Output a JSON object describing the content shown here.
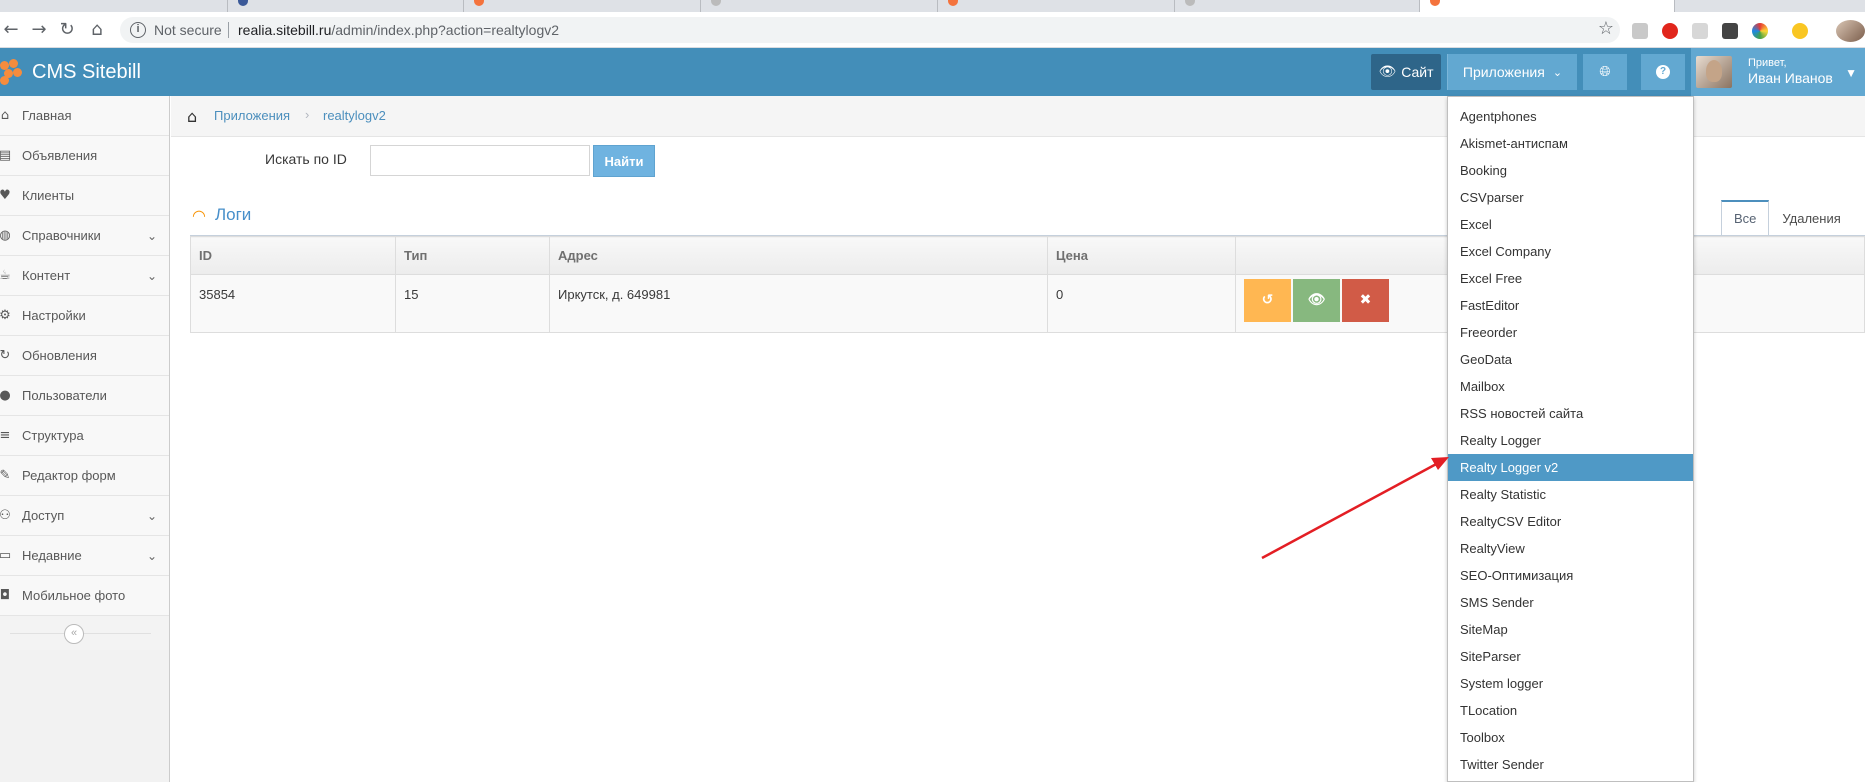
{
  "browser": {
    "not_secure": "Not secure",
    "url_host": "realia.sitebill.ru",
    "url_path": "/admin/index.php?action=realtylogv2"
  },
  "icons": {
    "back": "back-arrow-icon",
    "forward": "forward-arrow-icon",
    "reload": "reload-icon",
    "home": "home-icon",
    "star": "star-icon",
    "rss": "rss-icon",
    "globe": "globe-icon",
    "help": "question-icon"
  },
  "colors": {
    "navbar": "#438eb9",
    "accent": "#4f99c6",
    "restore": "#ffb752",
    "view": "#87b87f",
    "delete": "#d15b47",
    "arrow": "#e31e24"
  },
  "navbar": {
    "brand": "CMS Sitebill",
    "site_label": "Сайт",
    "apps_label": "Приложения",
    "greeting": "Привет,",
    "user_name": "Иван Иванов"
  },
  "sidebar": {
    "items": [
      {
        "label": "Главная",
        "icon": "home-icon",
        "has_children": false
      },
      {
        "label": "Объявления",
        "icon": "book-icon",
        "has_children": false
      },
      {
        "label": "Клиенты",
        "icon": "heart-icon",
        "has_children": false
      },
      {
        "label": "Справочники",
        "icon": "globe-icon",
        "has_children": true
      },
      {
        "label": "Контент",
        "icon": "coffee-icon",
        "has_children": true
      },
      {
        "label": "Настройки",
        "icon": "gear-icon",
        "has_children": false
      },
      {
        "label": "Обновления",
        "icon": "refresh-icon",
        "has_children": false
      },
      {
        "label": "Пользователи",
        "icon": "user-icon",
        "has_children": false
      },
      {
        "label": "Структура",
        "icon": "list-icon",
        "has_children": false
      },
      {
        "label": "Редактор форм",
        "icon": "edit-icon",
        "has_children": false
      },
      {
        "label": "Доступ",
        "icon": "users-icon",
        "has_children": true
      },
      {
        "label": "Недавние",
        "icon": "desktop-icon",
        "has_children": true
      },
      {
        "label": "Мобильное фото",
        "icon": "camera-icon",
        "has_children": false
      }
    ]
  },
  "breadcrumb": {
    "items": [
      "Приложения",
      "realtylogv2"
    ]
  },
  "search": {
    "label": "Искать по ID",
    "value": "",
    "button": "Найти"
  },
  "logs": {
    "title": "Логи",
    "tabs": [
      {
        "label": "Все",
        "active": true
      },
      {
        "label": "Удаления",
        "active": false
      }
    ],
    "columns": [
      "ID",
      "Тип",
      "Адрес",
      "Цена",
      ""
    ],
    "rows": [
      {
        "id": "35854",
        "type": "15",
        "address": "Иркутск, д. 649981",
        "price": "0"
      }
    ]
  },
  "apps_menu": {
    "active_index": 13,
    "items": [
      "Agentphones",
      "Akismet-антиспам",
      "Booking",
      "CSVparser",
      "Excel",
      "Excel Company",
      "Excel Free",
      "FastEditor",
      "Freeorder",
      "GeoData",
      "Mailbox",
      "RSS новостей сайта",
      "Realty Logger",
      "Realty Logger v2",
      "Realty Statistic",
      "RealtyCSV Editor",
      "RealtyView",
      "SEO-Оптимизация",
      "SMS Sender",
      "SiteMap",
      "SiteParser",
      "System logger",
      "TLocation",
      "Toolbox",
      "Twitter Sender"
    ]
  }
}
